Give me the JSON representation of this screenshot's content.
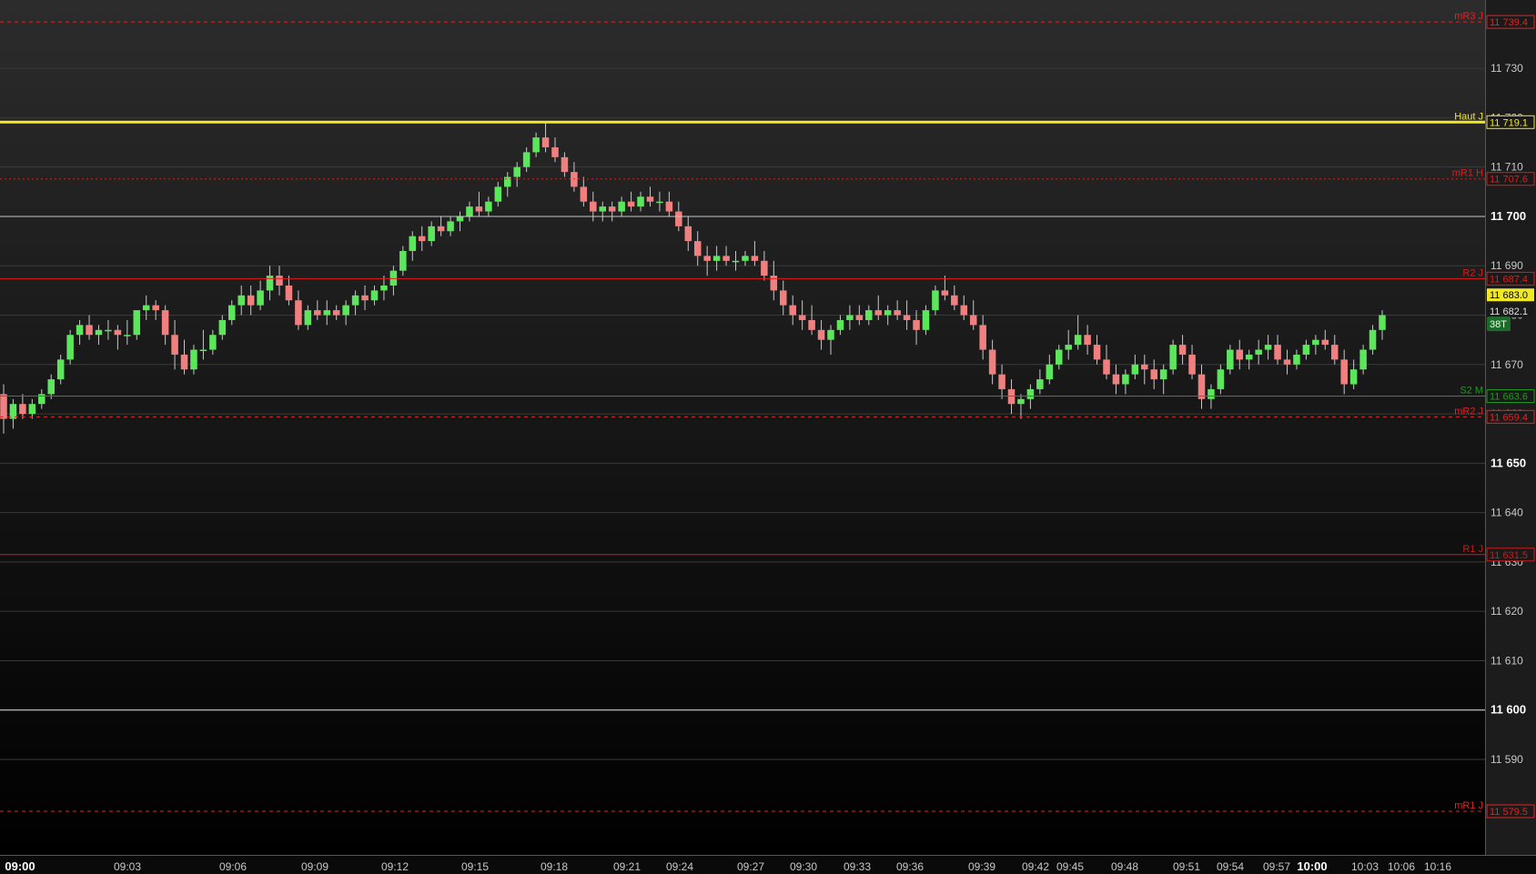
{
  "chart_data": {
    "type": "candlestick",
    "title": "",
    "xlabel": "",
    "ylabel": "",
    "ylim": [
      11572.5,
      11742
    ],
    "xlim": [
      "09:00",
      "10:17"
    ],
    "grid": true,
    "y_ticks": [
      {
        "value": 11730,
        "label": "11 730",
        "bold": false
      },
      {
        "value": 11720,
        "label": "11 720",
        "bold": false
      },
      {
        "value": 11710,
        "label": "11 710",
        "bold": false
      },
      {
        "value": 11700,
        "label": "11 700",
        "bold": true
      },
      {
        "value": 11690,
        "label": "11 690",
        "bold": false
      },
      {
        "value": 11680,
        "label": "11 680",
        "bold": false
      },
      {
        "value": 11670,
        "label": "11 670",
        "bold": false
      },
      {
        "value": 11660,
        "label": "11 660",
        "bold": false
      },
      {
        "value": 11650,
        "label": "11 650",
        "bold": true
      },
      {
        "value": 11640,
        "label": "11 640",
        "bold": false
      },
      {
        "value": 11630,
        "label": "11 630",
        "bold": false
      },
      {
        "value": 11620,
        "label": "11 620",
        "bold": false
      },
      {
        "value": 11610,
        "label": "11 610",
        "bold": false
      },
      {
        "value": 11600,
        "label": "11 600",
        "bold": true
      },
      {
        "value": 11590,
        "label": "11 590",
        "bold": false
      }
    ],
    "x_ticks": [
      {
        "label": "09:00",
        "bold": true
      },
      {
        "label": "09:03",
        "bold": false
      },
      {
        "label": "09:06",
        "bold": false
      },
      {
        "label": "09:09",
        "bold": false
      },
      {
        "label": "09:12",
        "bold": false
      },
      {
        "label": "09:15",
        "bold": false
      },
      {
        "label": "09:18",
        "bold": false
      },
      {
        "label": "09:21",
        "bold": false
      },
      {
        "label": "09:24",
        "bold": false
      },
      {
        "label": "09:27",
        "bold": false
      },
      {
        "label": "09:30",
        "bold": false
      },
      {
        "label": "09:33",
        "bold": false
      },
      {
        "label": "09:36",
        "bold": false
      },
      {
        "label": "09:39",
        "bold": false
      },
      {
        "label": "09:42",
        "bold": false
      },
      {
        "label": "09:45",
        "bold": false
      },
      {
        "label": "09:48",
        "bold": false
      },
      {
        "label": "09:51",
        "bold": false
      },
      {
        "label": "09:54",
        "bold": false
      },
      {
        "label": "09:57",
        "bold": false
      },
      {
        "label": "10:00",
        "bold": true
      },
      {
        "label": "10:03",
        "bold": false
      },
      {
        "label": "10:06",
        "bold": false
      },
      {
        "label": "10:16",
        "bold": false
      }
    ],
    "levels": [
      {
        "name": "mR3 J",
        "value": 11739.4,
        "label": "11 739.4",
        "color": "#e02424",
        "style": "dashed"
      },
      {
        "name": "Haut J",
        "value": 11719.1,
        "label": "11 719.1",
        "color": "#f2e82a",
        "style": "solid-thick"
      },
      {
        "name": "mR1 H",
        "value": 11707.6,
        "label": "11 707.6",
        "color": "#d42020",
        "style": "dashed-thin"
      },
      {
        "name": "",
        "value": 11700,
        "label": "",
        "color": "#c8c8c8",
        "style": "solid"
      },
      {
        "name": "R2 J",
        "value": 11687.4,
        "label": "11 687.4",
        "color": "#e01c1c",
        "style": "solid"
      },
      {
        "name": "S2 M",
        "value": 11663.6,
        "label": "11 663.6",
        "color": "#1f9a1f",
        "style": "solid"
      },
      {
        "name": "mR2 J",
        "value": 11659.4,
        "label": "11 659.4",
        "color": "#e02424",
        "style": "dashed"
      },
      {
        "name": "R1 J",
        "value": 11631.5,
        "label": "11 631.5",
        "color": "#c81c1c",
        "style": "solid-thin"
      },
      {
        "name": "",
        "value": 11600,
        "label": "",
        "color": "#e0e0e0",
        "style": "solid"
      },
      {
        "name": "mR1 J",
        "value": 11579.5,
        "label": "11 579.5",
        "color": "#e02424",
        "style": "dashed"
      }
    ],
    "price_markers": [
      {
        "value": 11683.0,
        "label": "11 683.0",
        "bg": "#f2e82a",
        "fg": "#000000"
      },
      {
        "value": 11682.1,
        "label": "11 682.1",
        "bg": "#1a1a1a",
        "fg": "#e0e0e0"
      }
    ],
    "tick_counter": "38T",
    "colors": {
      "up": "#5ce65c",
      "down": "#f08080",
      "wick": "#c8c8c8",
      "grid": "#3a3a3a",
      "axis_text": "#c8c8c8"
    },
    "candles": [
      [
        11664,
        11666,
        11656,
        11659
      ],
      [
        11659,
        11663,
        11657,
        11662
      ],
      [
        11662,
        11664,
        11659,
        11660
      ],
      [
        11660,
        11663,
        11659,
        11662
      ],
      [
        11662,
        11665,
        11661,
        11664
      ],
      [
        11664,
        11668,
        11663,
        11667
      ],
      [
        11667,
        11672,
        11666,
        11671
      ],
      [
        11671,
        11677,
        11670,
        11676
      ],
      [
        11676,
        11679,
        11674,
        11678
      ],
      [
        11678,
        11680,
        11675,
        11676
      ],
      [
        11676,
        11678,
        11674,
        11677
      ],
      [
        11677,
        11679,
        11675,
        11677
      ],
      [
        11677,
        11678,
        11673,
        11676
      ],
      [
        11676,
        11679,
        11674,
        11676
      ],
      [
        11676,
        11681,
        11675,
        11681
      ],
      [
        11681,
        11684,
        11679,
        11682
      ],
      [
        11682,
        11683,
        11679,
        11681
      ],
      [
        11681,
        11682,
        11674,
        11676
      ],
      [
        11676,
        11679,
        11669,
        11672
      ],
      [
        11672,
        11675,
        11668,
        11669
      ],
      [
        11669,
        11674,
        11668,
        11673
      ],
      [
        11673,
        11677,
        11671,
        11673
      ],
      [
        11673,
        11677,
        11672,
        11676
      ],
      [
        11676,
        11680,
        11675,
        11679
      ],
      [
        11679,
        11683,
        11678,
        11682
      ],
      [
        11682,
        11686,
        11680,
        11684
      ],
      [
        11684,
        11686,
        11680,
        11682
      ],
      [
        11682,
        11687,
        11681,
        11685
      ],
      [
        11685,
        11690,
        11683,
        11688
      ],
      [
        11688,
        11690,
        11684,
        11686
      ],
      [
        11686,
        11688,
        11682,
        11683
      ],
      [
        11683,
        11685,
        11677,
        11678
      ],
      [
        11678,
        11682,
        11677,
        11681
      ],
      [
        11681,
        11683,
        11679,
        11680
      ],
      [
        11680,
        11683,
        11678,
        11681
      ],
      [
        11681,
        11682,
        11679,
        11680
      ],
      [
        11680,
        11683,
        11678,
        11682
      ],
      [
        11682,
        11685,
        11680,
        11684
      ],
      [
        11684,
        11686,
        11681,
        11683
      ],
      [
        11683,
        11686,
        11682,
        11685
      ],
      [
        11685,
        11688,
        11683,
        11686
      ],
      [
        11686,
        11690,
        11684,
        11689
      ],
      [
        11689,
        11694,
        11688,
        11693
      ],
      [
        11693,
        11697,
        11691,
        11696
      ],
      [
        11696,
        11698,
        11693,
        11695
      ],
      [
        11695,
        11699,
        11694,
        11698
      ],
      [
        11698,
        11700,
        11696,
        11697
      ],
      [
        11697,
        11700,
        11696,
        11699
      ],
      [
        11699,
        11701,
        11697,
        11700
      ],
      [
        11700,
        11703,
        11699,
        11702
      ],
      [
        11702,
        11705,
        11700,
        11701
      ],
      [
        11701,
        11704,
        11700,
        11703
      ],
      [
        11703,
        11707,
        11702,
        11706
      ],
      [
        11706,
        11709,
        11704,
        11708
      ],
      [
        11708,
        11711,
        11706,
        11710
      ],
      [
        11710,
        11714,
        11709,
        11713
      ],
      [
        11713,
        11717,
        11712,
        11716
      ],
      [
        11716,
        11719,
        11713,
        11714
      ],
      [
        11714,
        11716,
        11711,
        11712
      ],
      [
        11712,
        11713,
        11708,
        11709
      ],
      [
        11709,
        11711,
        11705,
        11706
      ],
      [
        11706,
        11708,
        11702,
        11703
      ],
      [
        11703,
        11705,
        11699,
        11701
      ],
      [
        11701,
        11703,
        11699,
        11702
      ],
      [
        11702,
        11703,
        11699,
        11701
      ],
      [
        11701,
        11704,
        11700,
        11703
      ],
      [
        11703,
        11705,
        11701,
        11702
      ],
      [
        11702,
        11705,
        11701,
        11704
      ],
      [
        11704,
        11706,
        11702,
        11703
      ],
      [
        11703,
        11705,
        11701,
        11703
      ],
      [
        11703,
        11705,
        11700,
        11701
      ],
      [
        11701,
        11703,
        11697,
        11698
      ],
      [
        11698,
        11700,
        11693,
        11695
      ],
      [
        11695,
        11697,
        11690,
        11692
      ],
      [
        11692,
        11694,
        11688,
        11691
      ],
      [
        11691,
        11694,
        11689,
        11692
      ],
      [
        11692,
        11694,
        11690,
        11691
      ],
      [
        11691,
        11693,
        11689,
        11691
      ],
      [
        11691,
        11693,
        11690,
        11692
      ],
      [
        11692,
        11695,
        11690,
        11691
      ],
      [
        11691,
        11693,
        11687,
        11688
      ],
      [
        11688,
        11691,
        11683,
        11685
      ],
      [
        11685,
        11687,
        11680,
        11682
      ],
      [
        11682,
        11684,
        11678,
        11680
      ],
      [
        11680,
        11683,
        11677,
        11679
      ],
      [
        11679,
        11682,
        11676,
        11677
      ],
      [
        11677,
        11679,
        11673,
        11675
      ],
      [
        11675,
        11678,
        11672,
        11677
      ],
      [
        11677,
        11680,
        11676,
        11679
      ],
      [
        11679,
        11682,
        11677,
        11680
      ],
      [
        11680,
        11682,
        11678,
        11679
      ],
      [
        11679,
        11682,
        11678,
        11681
      ],
      [
        11681,
        11684,
        11679,
        11680
      ],
      [
        11680,
        11682,
        11678,
        11681
      ],
      [
        11681,
        11683,
        11679,
        11680
      ],
      [
        11680,
        11683,
        11677,
        11679
      ],
      [
        11679,
        11681,
        11674,
        11677
      ],
      [
        11677,
        11682,
        11676,
        11681
      ],
      [
        11681,
        11686,
        11680,
        11685
      ],
      [
        11685,
        11688,
        11683,
        11684
      ],
      [
        11684,
        11686,
        11681,
        11682
      ],
      [
        11682,
        11684,
        11679,
        11680
      ],
      [
        11680,
        11683,
        11677,
        11678
      ],
      [
        11678,
        11680,
        11671,
        11673
      ],
      [
        11673,
        11675,
        11666,
        11668
      ],
      [
        11668,
        11670,
        11663,
        11665
      ],
      [
        11665,
        11667,
        11660,
        11662
      ],
      [
        11662,
        11664,
        11659,
        11663
      ],
      [
        11663,
        11666,
        11661,
        11665
      ],
      [
        11665,
        11669,
        11664,
        11667
      ],
      [
        11667,
        11672,
        11666,
        11670
      ],
      [
        11670,
        11674,
        11669,
        11673
      ],
      [
        11673,
        11677,
        11671,
        11674
      ],
      [
        11674,
        11680,
        11673,
        11676
      ],
      [
        11676,
        11678,
        11672,
        11674
      ],
      [
        11674,
        11676,
        11670,
        11671
      ],
      [
        11671,
        11674,
        11667,
        11668
      ],
      [
        11668,
        11670,
        11664,
        11666
      ],
      [
        11666,
        11669,
        11664,
        11668
      ],
      [
        11668,
        11672,
        11667,
        11670
      ],
      [
        11670,
        11672,
        11666,
        11669
      ],
      [
        11669,
        11671,
        11665,
        11667
      ],
      [
        11667,
        11670,
        11664,
        11669
      ],
      [
        11669,
        11675,
        11668,
        11674
      ],
      [
        11674,
        11676,
        11670,
        11672
      ],
      [
        11672,
        11674,
        11667,
        11668
      ],
      [
        11668,
        11670,
        11661,
        11663
      ],
      [
        11663,
        11666,
        11661,
        11665
      ],
      [
        11665,
        11670,
        11664,
        11669
      ],
      [
        11669,
        11674,
        11668,
        11673
      ],
      [
        11673,
        11675,
        11669,
        11671
      ],
      [
        11671,
        11673,
        11669,
        11672
      ],
      [
        11672,
        11675,
        11670,
        11673
      ],
      [
        11673,
        11676,
        11671,
        11674
      ],
      [
        11674,
        11676,
        11670,
        11671
      ],
      [
        11671,
        11673,
        11668,
        11670
      ],
      [
        11670,
        11673,
        11669,
        11672
      ],
      [
        11672,
        11675,
        11671,
        11674
      ],
      [
        11674,
        11676,
        11672,
        11675
      ],
      [
        11675,
        11677,
        11673,
        11674
      ],
      [
        11674,
        11676,
        11670,
        11671
      ],
      [
        11671,
        11673,
        11664,
        11666
      ],
      [
        11666,
        11671,
        11665,
        11669
      ],
      [
        11669,
        11674,
        11668,
        11673
      ],
      [
        11673,
        11678,
        11672,
        11677
      ],
      [
        11677,
        11681,
        11675,
        11680
      ]
    ]
  }
}
